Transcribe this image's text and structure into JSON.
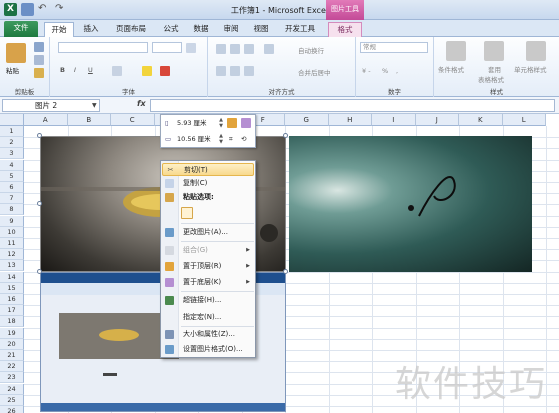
{
  "window": {
    "title": "工作簿1 - Microsoft Excel",
    "context_tool": "图片工具"
  },
  "tabs": [
    "文件",
    "开始",
    "插入",
    "页面布局",
    "公式",
    "数据",
    "审阅",
    "视图",
    "开发工具",
    "格式"
  ],
  "ribbon": {
    "paste_label": "粘贴",
    "clipboard_group": "剪贴板",
    "font_group": "字体",
    "align_group": "对齐方式",
    "wrap_text": "自动换行",
    "merge_center": "合并后居中",
    "number_group": "数字",
    "number_format": "常规",
    "styles_group": "样式",
    "cond_format": "条件格式",
    "table_format_1": "套用",
    "table_format_2": "表格格式",
    "cell_styles": "单元格样式"
  },
  "formula_bar": {
    "name_box": "图片 2",
    "fx": "fx"
  },
  "columns": [
    "A",
    "B",
    "C",
    "D",
    "E",
    "F",
    "G",
    "H",
    "I",
    "J",
    "K",
    "L"
  ],
  "rows": [
    "1",
    "2",
    "3",
    "4",
    "5",
    "6",
    "7",
    "8",
    "9",
    "10",
    "11",
    "12",
    "13",
    "14",
    "15",
    "16",
    "17",
    "18",
    "19",
    "20",
    "21",
    "22",
    "23",
    "24",
    "25",
    "26"
  ],
  "mini_toolbar": {
    "height": "5.93 厘米",
    "width": "10.56 厘米"
  },
  "context_menu": {
    "cut": "剪切(T)",
    "copy": "复制(C)",
    "paste_options": "粘贴选项:",
    "change_picture": "更改图片(A)...",
    "group": "组合(G)",
    "bring_front": "置于顶层(R)",
    "send_back": "置于底层(K)",
    "hyperlink": "超链接(H)...",
    "assign_macro": "指定宏(N)...",
    "size_props": "大小和属性(Z)...",
    "format_picture": "设置图片格式(O)..."
  },
  "watermark": "软件技巧"
}
